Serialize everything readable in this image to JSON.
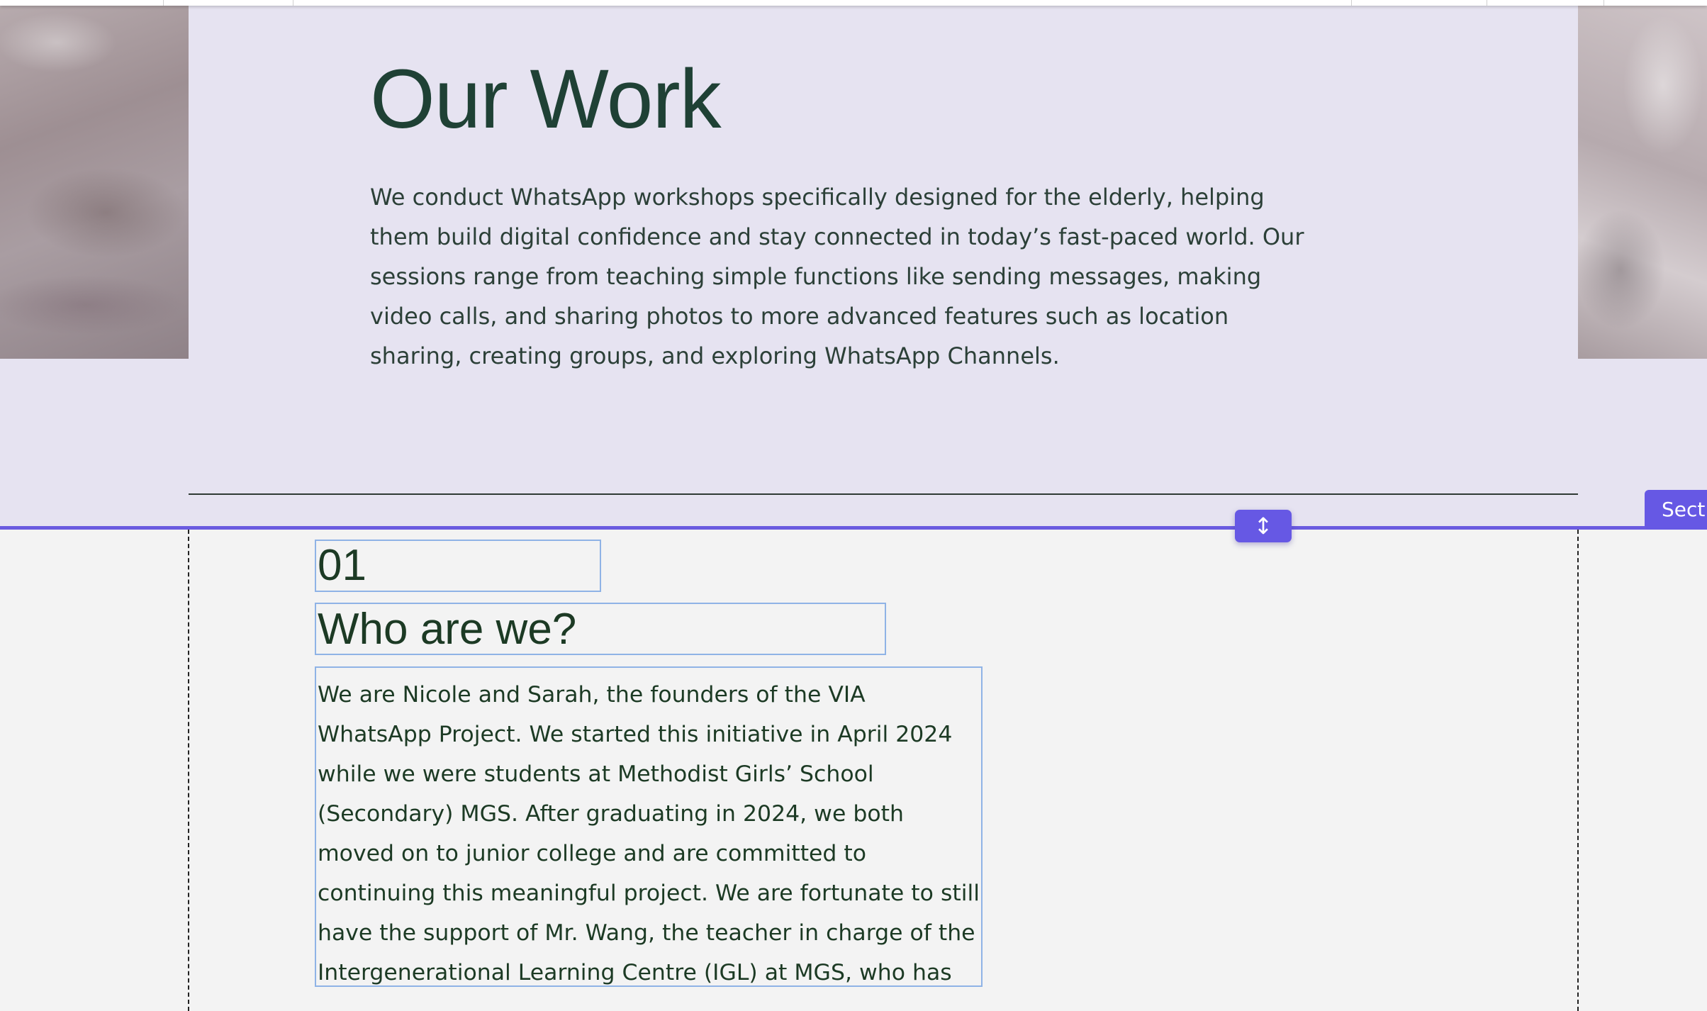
{
  "toolbar": {},
  "section_top": {
    "title": "Our Work",
    "intro": "We conduct WhatsApp workshops specifically designed for the elderly, helping them build digital confidence and stay connected in today’s fast-paced world. Our sessions range from teaching simple functions like sending messages, making video calls, and sharing photos to more advanced features such as location sharing, creating groups, and exploring WhatsApp Channels."
  },
  "editor": {
    "resize_icon": "vertical-resize-icon",
    "resize_glyph": "↕",
    "section_tag_label": "Sect"
  },
  "section_about": {
    "number": "01",
    "heading": "Who are we?",
    "body": "We are Nicole and Sarah, the founders of the VIA WhatsApp Project. We started this initiative in April 2024 while we were students at Methodist Girls’ School (Secondary) MGS. After graduating in 2024, we both moved on to junior college and are committed to continuing this meaningful project. We are fortunate to still have the support of Mr. Wang, the teacher in charge of the Intergenerational Learning Centre (IGL) at MGS, who has been instrumental in guiding us along the way"
  },
  "colors": {
    "section_top_bg": "#e6e3f1",
    "section_lower_bg": "#f3f3f3",
    "accent": "#6658e4",
    "heading_text": "#1f4135",
    "selection_border": "#8fb3e6"
  }
}
